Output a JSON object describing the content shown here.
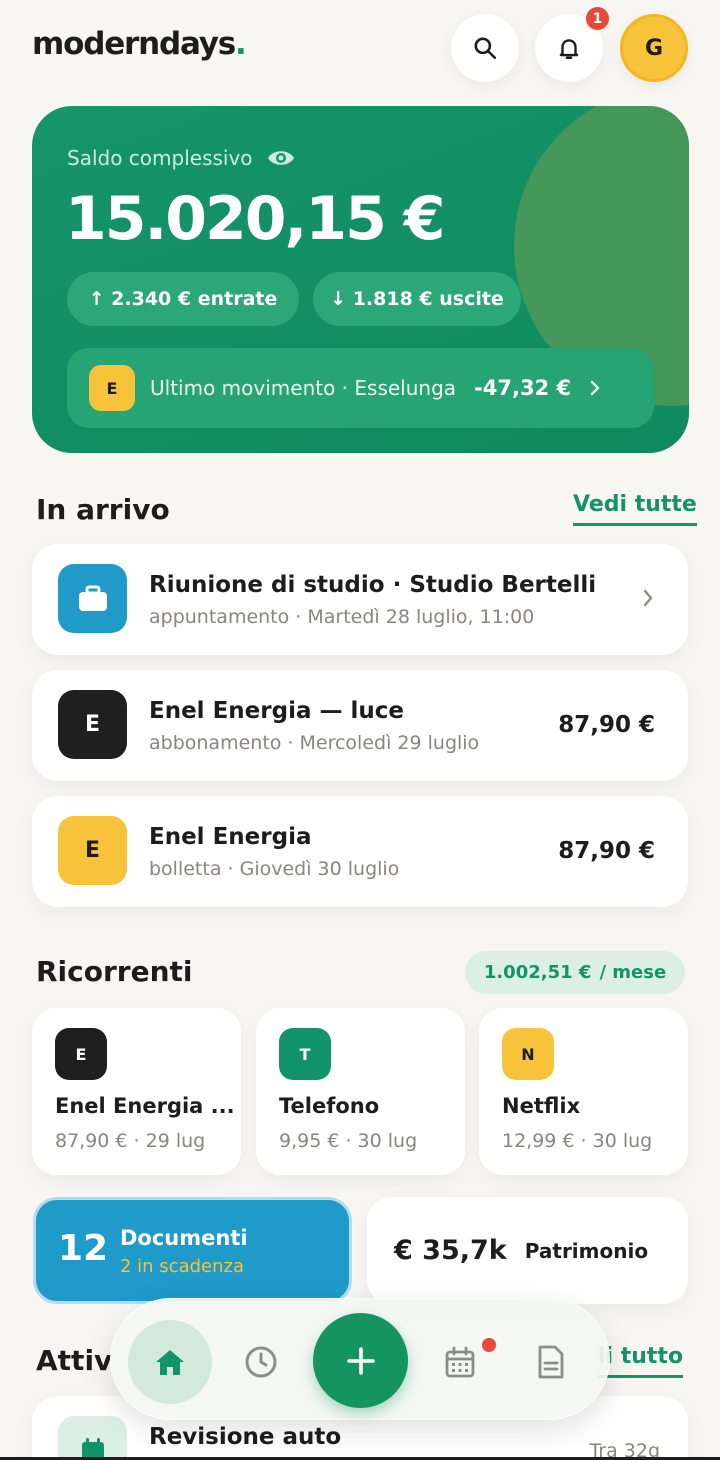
{
  "header": {
    "logo": "moderndays",
    "logo_dot": ".",
    "notification_count": "1",
    "avatar_initial": "G"
  },
  "balance": {
    "label": "Saldo complessivo",
    "amount": "15.020,15 €",
    "income": "↑ 2.340 €  entrate",
    "expenses": "↓ 1.818 €  uscite",
    "last_movement": {
      "icon_letter": "E",
      "text": "Ultimo movimento · Esselunga",
      "amount": "-47,32 €"
    }
  },
  "upcoming": {
    "title": "In arrivo",
    "see_all": "Vedi tutte",
    "items": [
      {
        "icon": "briefcase-icon",
        "color": "#1f9ac9",
        "title": "Riunione di studio · Studio Bertelli",
        "subtitle": "appuntamento · Martedì 28 luglio, 11:00",
        "amount": ""
      },
      {
        "icon_letter": "E",
        "color": "#1f1f1f",
        "title": "Enel Energia — luce",
        "subtitle": "abbonamento · Mercoledì 29 luglio",
        "amount": "87,90 €"
      },
      {
        "icon_letter": "E",
        "color": "#f7c33a",
        "title": "Enel Energia",
        "subtitle": "bolletta · Giovedì 30 luglio",
        "amount": "87,90 €"
      }
    ]
  },
  "recurring": {
    "title": "Ricorrenti",
    "total": "1.002,51 €",
    "total_unit": "/ mese",
    "items": [
      {
        "letter": "E",
        "color": "#1f1f1f",
        "name": "Enel Energia ...",
        "meta": "87,90 €  · 29 lug"
      },
      {
        "letter": "T",
        "color": "#12936a",
        "name": "Telefono",
        "meta": "9,95 €  · 30 lug"
      },
      {
        "letter": "N",
        "color": "#f7c33a",
        "name": "Netflix",
        "meta": "12,99 €  · 30 lug"
      }
    ]
  },
  "documents": {
    "count": "12",
    "title": "Documenti",
    "subtitle": "2 in scadenza"
  },
  "networth": {
    "amount": "€ 35,7k",
    "label": "Patrimonio"
  },
  "activity": {
    "title_partial": "Attiv",
    "see_all_partial": "li tutto",
    "item": {
      "title": "Revisione auto",
      "right": "Tra 32g"
    }
  },
  "colors": {
    "brand_green": "#12936a",
    "accent_yellow": "#f7c33a",
    "accent_blue": "#1f9ac9",
    "alert_red": "#e9483b"
  }
}
